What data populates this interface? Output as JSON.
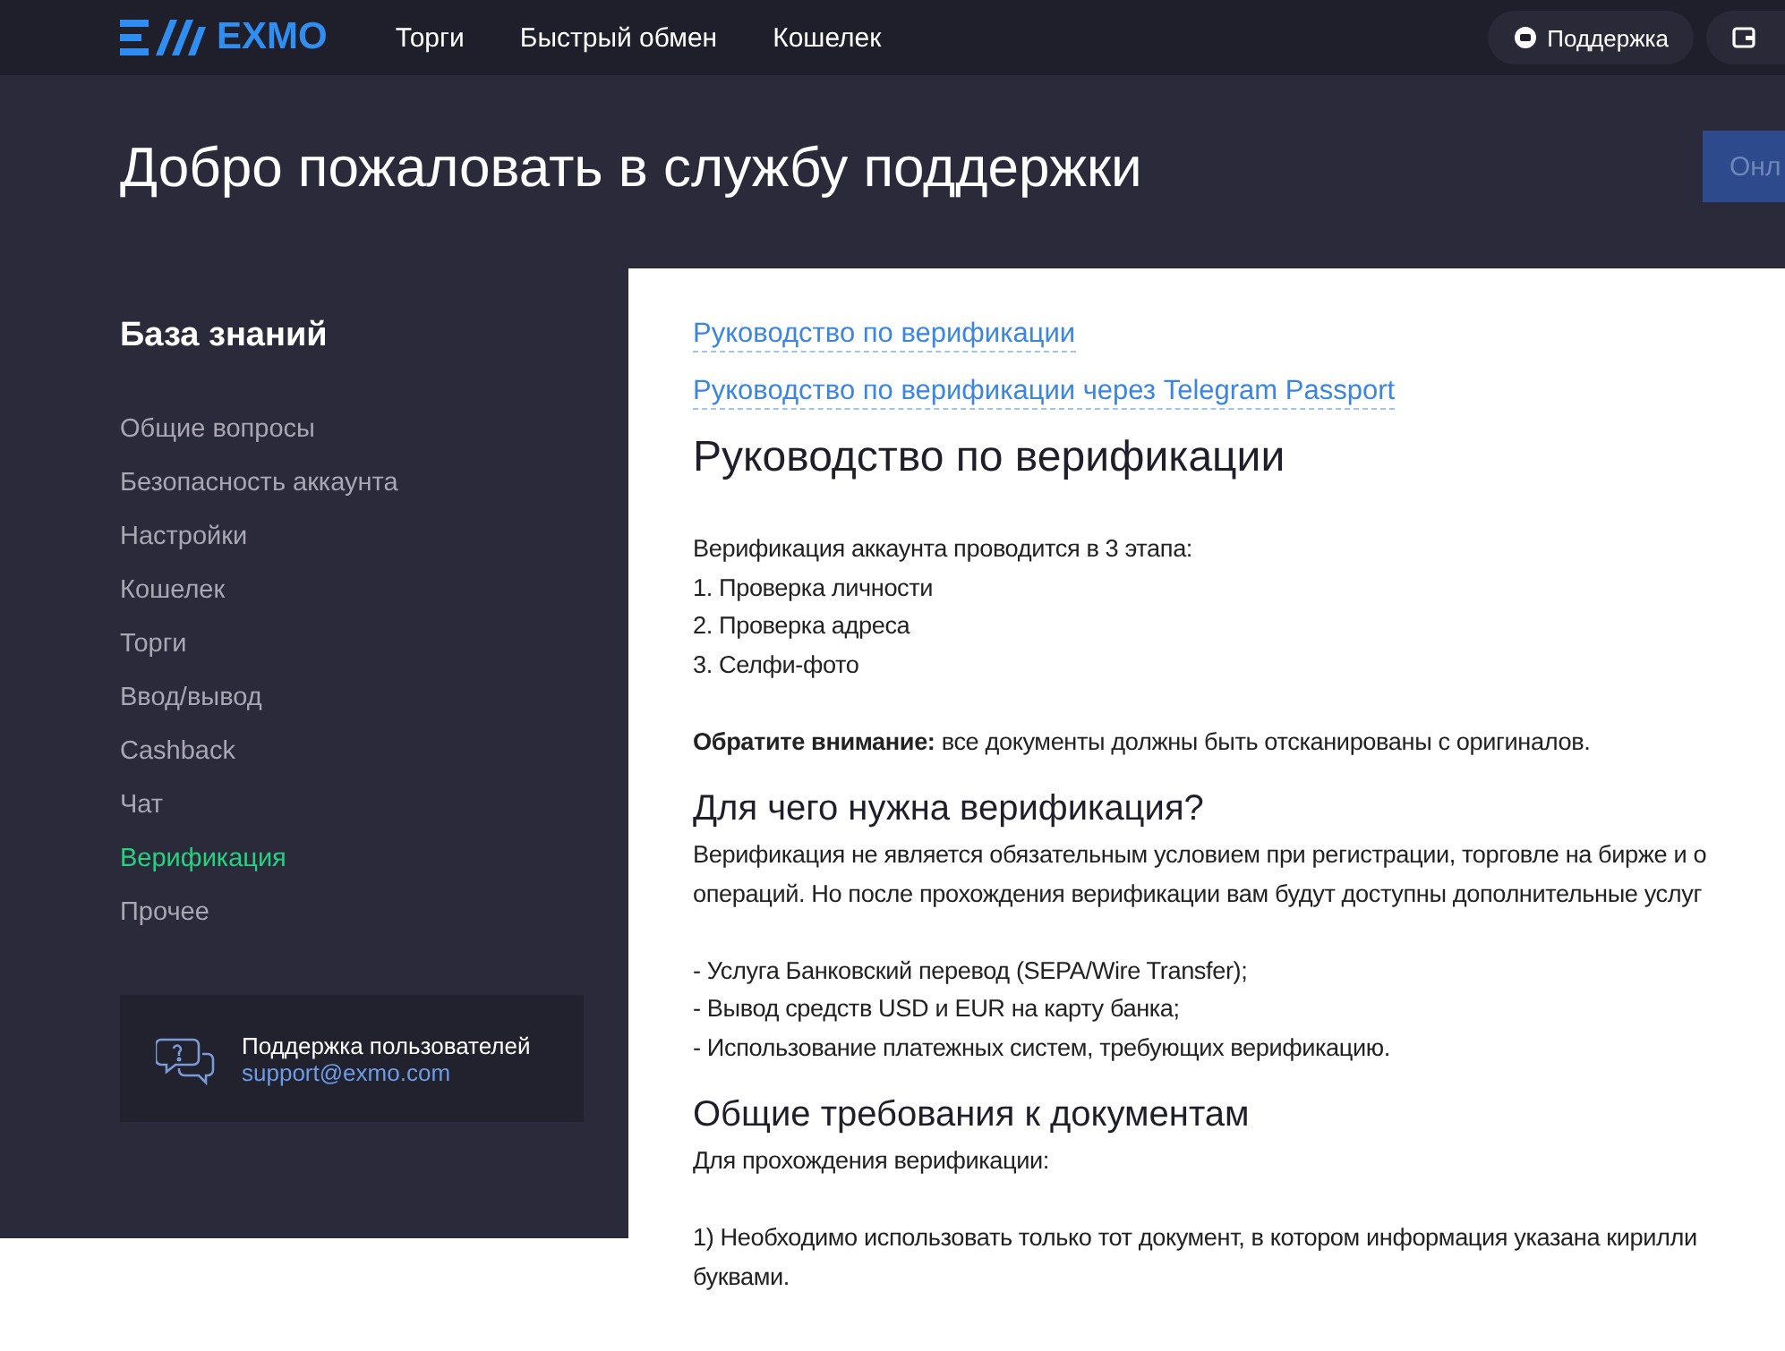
{
  "nav": {
    "logo": "EXMO",
    "items": [
      "Торги",
      "Быстрый обмен",
      "Кошелек"
    ],
    "support_button": "Поддержка"
  },
  "hero": {
    "title": "Добро пожаловать в службу поддержки",
    "button": "Онл"
  },
  "sidebar": {
    "title": "База знаний",
    "items": [
      {
        "label": "Общие вопросы",
        "selected": false
      },
      {
        "label": "Безопасность аккаунта",
        "selected": false
      },
      {
        "label": "Настройки",
        "selected": false
      },
      {
        "label": "Кошелек",
        "selected": false
      },
      {
        "label": "Торги",
        "selected": false
      },
      {
        "label": "Ввод/вывод",
        "selected": false
      },
      {
        "label": "Cashback",
        "selected": false
      },
      {
        "label": "Чат",
        "selected": false
      },
      {
        "label": "Верификация",
        "selected": true
      },
      {
        "label": "Прочее",
        "selected": false
      }
    ],
    "support_card": {
      "title": "Поддержка пользователей",
      "email": "support@exmo.com"
    }
  },
  "article": {
    "links": [
      "Руководство по верификации",
      "Руководство по верификации через Telegram Passport"
    ],
    "blocks": [
      {
        "kind": "h1",
        "text": "Руководство по верификации"
      },
      {
        "kind": "line",
        "text": "Верификация аккаунта проводится в 3 этапа:"
      },
      {
        "kind": "line",
        "text": "1. Проверка личности"
      },
      {
        "kind": "line",
        "text": "2. Проверка адреса"
      },
      {
        "kind": "line",
        "text": "3. Селфи-фото"
      },
      {
        "kind": "gap"
      },
      {
        "kind": "line",
        "text": "**Обратите внимание:** все документы должны быть отсканированы с оригиналов."
      },
      {
        "kind": "h2",
        "text": "Для чего нужна верификация?"
      },
      {
        "kind": "line",
        "text": "Верификация не является обязательным условием при регистрации, торговле на бирже и о"
      },
      {
        "kind": "line",
        "text": "операций. Но после прохождения верификации вам будут доступны дополнительные услуг"
      },
      {
        "kind": "gap"
      },
      {
        "kind": "line",
        "text": "- Услуга Банковский перевод (SEPA/Wire Transfer);"
      },
      {
        "kind": "line",
        "text": "- Вывод средств USD и EUR на карту банка;"
      },
      {
        "kind": "line",
        "text": "- Использование платежных систем, требующих верификацию."
      },
      {
        "kind": "h2",
        "text": "Общие требования к документам"
      },
      {
        "kind": "line",
        "text": "Для прохождения верификации:"
      },
      {
        "kind": "gap"
      },
      {
        "kind": "line",
        "text": "1) Необходимо использовать только тот документ, в котором информация указана кирилли"
      },
      {
        "kind": "line",
        "text": "буквами."
      }
    ]
  }
}
